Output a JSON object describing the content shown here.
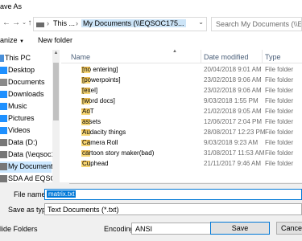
{
  "window": {
    "title": "ave As"
  },
  "address": {
    "segments": [
      "This ...",
      "My Documents (\\\\EQSOC175..."
    ],
    "current_index": 1
  },
  "search": {
    "placeholder": "Search My Documents (\\\\EQS..."
  },
  "toolbar": {
    "organize_label": "anize",
    "new_folder_label": "New folder"
  },
  "nav": {
    "items": [
      {
        "label": "This PC",
        "icon": "computer-icon",
        "color": "#4a90d9"
      },
      {
        "label": "Desktop",
        "icon": "desktop-icon",
        "color": "#1e90ff"
      },
      {
        "label": "Documents",
        "icon": "documents-icon",
        "color": "#8a8a8a"
      },
      {
        "label": "Downloads",
        "icon": "downloads-icon",
        "color": "#1e90ff"
      },
      {
        "label": "Music",
        "icon": "music-icon",
        "color": "#1e90ff"
      },
      {
        "label": "Pictures",
        "icon": "pictures-icon",
        "color": "#1e90ff"
      },
      {
        "label": "Videos",
        "icon": "videos-icon",
        "color": "#1e90ff"
      },
      {
        "label": "Data (D:)",
        "icon": "drive-icon",
        "color": "#777777"
      },
      {
        "label": "Data (\\\\eqsoc17...",
        "icon": "network-drive-icon",
        "color": "#777777"
      },
      {
        "label": "My Documents",
        "icon": "network-drive-icon",
        "color": "#777777"
      },
      {
        "label": "SDA Ad EQSO...",
        "icon": "network-drive-icon",
        "color": "#777777"
      }
    ],
    "selected_index": 9
  },
  "columns": {
    "name": "Name",
    "date": "Date modified",
    "type": "Type"
  },
  "files": [
    {
      "name": "[no entering]",
      "date": "20/04/2018 9:01 AM",
      "type": "File folder"
    },
    {
      "name": "[powerpoints]",
      "date": "23/02/2018 9:06 AM",
      "type": "File folder"
    },
    {
      "name": "[exel]",
      "date": "23/02/2018 9:06 AM",
      "type": "File folder"
    },
    {
      "name": "[word docs]",
      "date": "9/03/2018 1:55 PM",
      "type": "File folder"
    },
    {
      "name": "AoT",
      "date": "21/02/2018 9:05 AM",
      "type": "File folder"
    },
    {
      "name": "assets",
      "date": "12/06/2017 2:04 PM",
      "type": "File folder"
    },
    {
      "name": "Audacity things",
      "date": "28/08/2017 12:23 PM",
      "type": "File folder"
    },
    {
      "name": "Camera Roll",
      "date": "9/03/2018 9:23 AM",
      "type": "File folder"
    },
    {
      "name": "cartoon story maker(bad)",
      "date": "31/08/2017 11:53 AM",
      "type": "File folder"
    },
    {
      "name": "Cuphead",
      "date": "21/11/2017 9:46 AM",
      "type": "File folder"
    }
  ],
  "form": {
    "filename_label": "File name:",
    "filename_value": "matrix.txt",
    "savetype_label": "Save as type:",
    "savetype_value": "Text Documents (*.txt)",
    "encoding_label": "Encoding:",
    "encoding_value": "ANSI",
    "save_label": "Save",
    "cancel_label": "Cance",
    "hide_folders_label": "lide Folders"
  },
  "colors": {
    "accent": "#0078d7",
    "selection": "#cce8ff",
    "folder": "#f8d775"
  }
}
